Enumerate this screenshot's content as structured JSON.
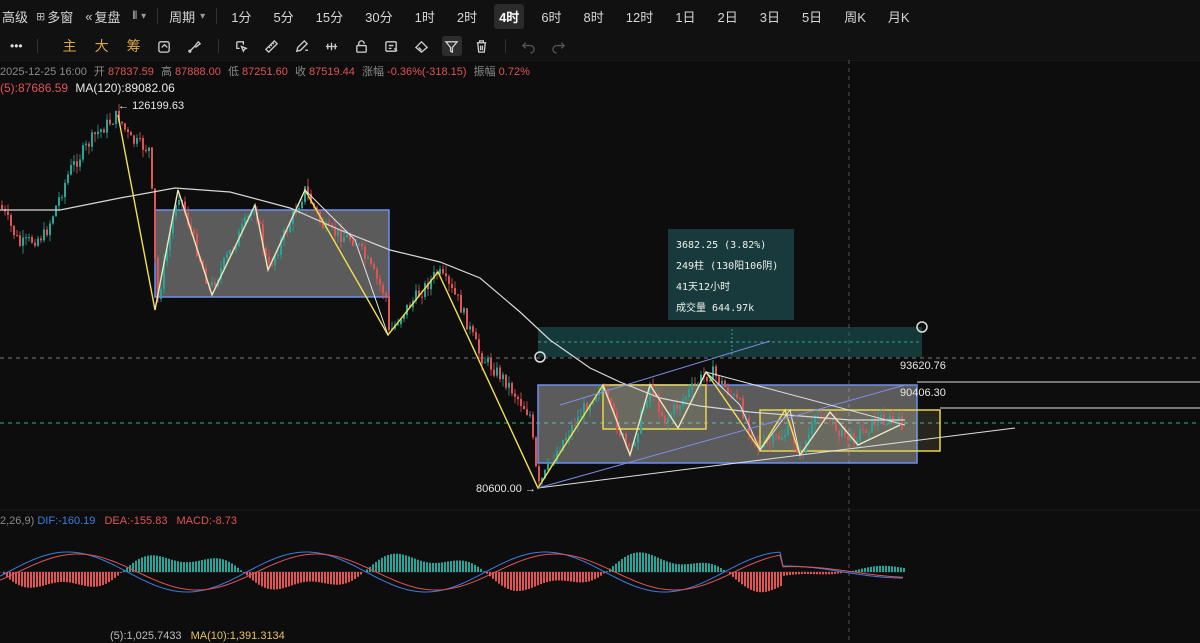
{
  "topbar": {
    "lead_items": [
      "高级",
      "多窗",
      "复盘",
      "周期"
    ],
    "timeframes": [
      "1分",
      "5分",
      "15分",
      "30分",
      "1时",
      "2时",
      "4时",
      "6时",
      "8时",
      "12时",
      "1日",
      "2日",
      "3日",
      "5日",
      "周K",
      "月K"
    ],
    "active_timeframe": "4时"
  },
  "toolbar": {
    "more": "•••",
    "indicator_labels": [
      "主",
      "大",
      "筹"
    ],
    "icons": [
      "redo-draw-icon",
      "brush-icon",
      "select-icon",
      "ruler-icon",
      "pencil-icon",
      "link-icon",
      "lock-icon",
      "magnet-icon",
      "layers-icon",
      "filter-icon",
      "trash-icon",
      "undo-icon",
      "redo-icon"
    ]
  },
  "ohlc": {
    "time": "2025-12-25 16:00",
    "open_label": "开",
    "open": "87837.59",
    "high_label": "高",
    "high": "87888.00",
    "low_label": "低",
    "low": "87251.60",
    "close_label": "收",
    "close": "87519.44",
    "change_label": "涨幅",
    "change": "-0.36%(-318.15)",
    "amplitude_label": "振幅",
    "amplitude": "0.72%"
  },
  "ma": {
    "ma5": "(5):87686.59",
    "ma120": "MA(120):89082.06"
  },
  "annotations": {
    "high_price": "126199.63",
    "low_price": "80600.00",
    "level_top": "93620.76",
    "level_mid": "90406.30"
  },
  "measure": {
    "change": "3682.25 (3.82%)",
    "bars": "249柱 (130阳106阴)",
    "duration": "41天12小时",
    "volume": "成交量 644.97k"
  },
  "macd": {
    "params": "2,26,9)",
    "dif": "DIF:-160.19",
    "dea": "DEA:-155.83",
    "macd": "MACD:-8.73"
  },
  "volume": {
    "ma5": "(5):1,025.7433",
    "ma10": "MA(10):1,391.3134"
  },
  "colors": {
    "bg": "#0d0d0d",
    "up": "#26a69a",
    "down": "#e05454",
    "zigzag": "#f2e24b",
    "box_blue": "#6f8ff0",
    "box_yellow": "#e8d64a",
    "measure_teal": "#183a3c"
  }
}
